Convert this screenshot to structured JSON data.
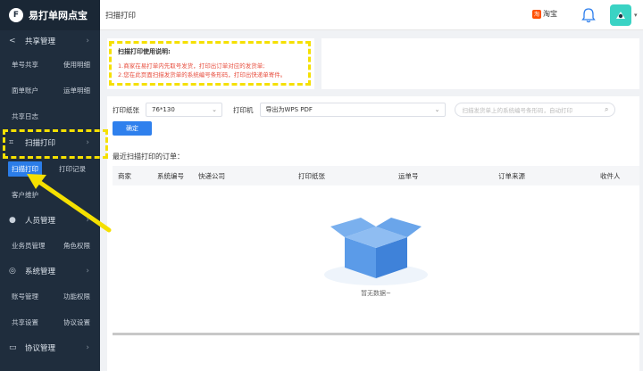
{
  "logo": {
    "mark": "F",
    "text": "易打单网点宝"
  },
  "sidebar": {
    "groups": [
      {
        "icon": "share-icon",
        "glyph": "‹",
        "label": "共享管理",
        "sub": [
          [
            "单号共享",
            "使用明细"
          ],
          [
            "面单账户",
            "运单明细"
          ],
          [
            "共享日志",
            ""
          ]
        ]
      },
      {
        "icon": "scan-icon",
        "glyph": "⌗",
        "label": "扫描打印",
        "sub": [
          [
            "扫描打印",
            "打印记录"
          ],
          [
            "客户维护",
            ""
          ]
        ]
      },
      {
        "icon": "user-icon",
        "glyph": "●",
        "label": "人员管理",
        "sub": [
          [
            "业务员管理",
            "角色权限"
          ]
        ]
      },
      {
        "icon": "gear-icon",
        "glyph": "◎",
        "label": "系统管理",
        "sub": [
          [
            "账号管理",
            "功能权限"
          ],
          [
            "共享设置",
            "协议设置"
          ]
        ]
      },
      {
        "icon": "doc-icon",
        "glyph": "▭",
        "label": "协议管理",
        "sub": []
      }
    ]
  },
  "header": {
    "title": "扫描打印",
    "taobao_badge": "淘",
    "taobao_label": "淘宝"
  },
  "note": {
    "title": "扫描打印使用说明:",
    "line1": "1.商家在易打单内先取号发货，打印出订单对应的发货单;",
    "line2": "2.您在此页面扫描发货单的系统编号条形码，打印出快递单寄件。"
  },
  "form": {
    "paper_label": "打印纸张",
    "paper_value": "76*130",
    "printer_label": "打印机",
    "printer_value": "导出为WPS PDF",
    "scan_placeholder": "扫描发货单上的系统编号条形码，自动打印",
    "confirm": "确定"
  },
  "recent_label": "最近扫描打印的订单：",
  "table": {
    "columns": [
      "商家",
      "系统编号",
      "快递公司",
      "打印纸张",
      "运单号",
      "订单来源",
      "收件人"
    ],
    "empty_text": "暂无数据~"
  },
  "colors": {
    "sidebar_bg": "#1f2d3d",
    "primary": "#2f80ed",
    "annotation": "#f5e000",
    "note_text": "#e74c3c"
  }
}
